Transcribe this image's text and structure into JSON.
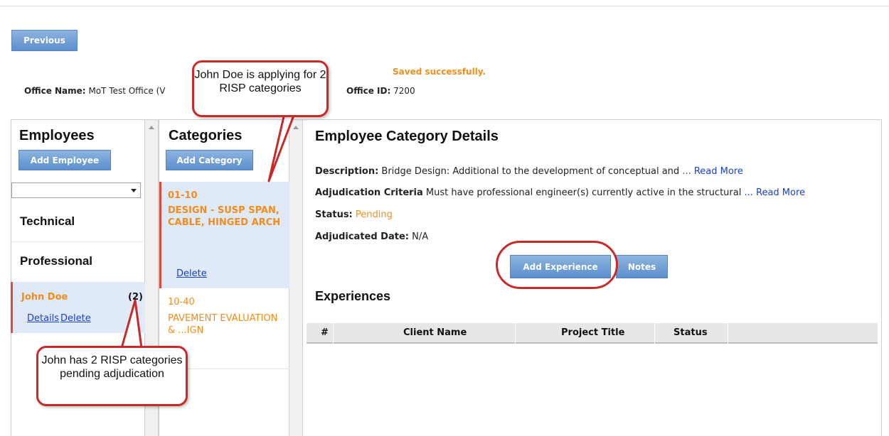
{
  "toolbar": {
    "previous_label": "Previous"
  },
  "message": {
    "saved": "Saved successfully."
  },
  "office": {
    "name_label": "Office Name:",
    "name_value": "MoT Test Office (V",
    "id_label": "Office ID:",
    "id_value": "7200"
  },
  "employees": {
    "title": "Employees",
    "add_label": "Add Employee",
    "groups": [
      "Technical",
      "Professional"
    ],
    "selected": {
      "name": "John Doe",
      "count": "(2)",
      "details_label": "Details",
      "delete_label": "Delete"
    }
  },
  "categories": {
    "title": "Categories",
    "add_label": "Add Category",
    "items": [
      {
        "code": "01-10",
        "name": "DESIGN - SUSP SPAN, CABLE, HINGED ARCH",
        "delete_label": "Delete"
      },
      {
        "code": "10-40",
        "name": "PAVEMENT EVALUATION & ...IGN"
      }
    ]
  },
  "details": {
    "title": "Employee Category Details",
    "description_label": "Description:",
    "description_value": "Bridge Design: Additional to the development of conceptual and",
    "criteria_label": "Adjudication Criteria",
    "criteria_value": "Must have professional engineer(s) currently active in the structural",
    "read_more": "... Read More",
    "status_label": "Status:",
    "status_value": "Pending",
    "adjudicated_label": "Adjudicated Date:",
    "adjudicated_value": "N/A",
    "add_experience_label": "Add Experience",
    "notes_label": "Notes"
  },
  "experiences": {
    "title": "Experiences",
    "columns": [
      "#",
      "Client Name",
      "Project Title",
      "Status"
    ]
  },
  "callouts": {
    "top": "John Doe is applying for 2 RISP categories",
    "bottom": "John has 2 RISP categories pending adjudication"
  },
  "colors": {
    "accent_orange": "#f28c1c",
    "callout_red": "#c82a2a",
    "selected_bg": "#dfe9f7",
    "button_blue": "#5b8fcc"
  }
}
